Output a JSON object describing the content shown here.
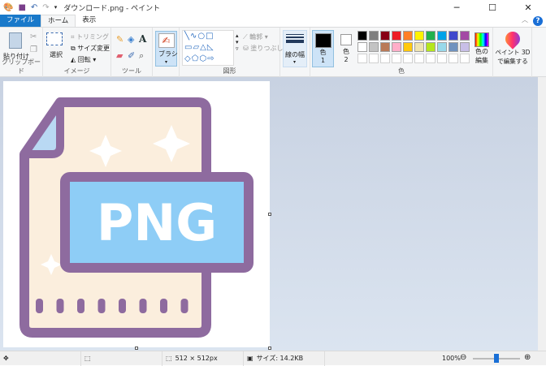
{
  "window": {
    "title": "ダウンロード.png - ペイント",
    "minimize": "─",
    "maximize": "☐",
    "close": "✕"
  },
  "tabs": [
    {
      "label": "ファイル"
    },
    {
      "label": "ホーム"
    },
    {
      "label": "表示"
    }
  ],
  "ribbon": {
    "clipboard": {
      "paste": "貼り付け",
      "label": "クリップボード"
    },
    "image": {
      "select": "選択",
      "crop": "トリミング",
      "resize": "サイズ変更",
      "rotate": "回転",
      "label": "イメージ"
    },
    "tools": {
      "label": "ツール"
    },
    "brush": {
      "label": "ブラシ"
    },
    "shapes": {
      "outline": "輪郭",
      "fill": "塗りつぶし",
      "label": "図形"
    },
    "size": {
      "label": "線の幅"
    },
    "colors": {
      "color1": "色\n1",
      "color1_a": "色",
      "color1_b": "1",
      "color2_a": "色",
      "color2_b": "2",
      "edit_a": "色の",
      "edit_b": "編集",
      "label": "色",
      "color1_value": "#000000",
      "color2_value": "#ffffff",
      "palette_row1": [
        "#000000",
        "#7f7f7f",
        "#880015",
        "#ed1c24",
        "#ff7f27",
        "#fff200",
        "#22b14c",
        "#00a2e8",
        "#3f48cc",
        "#a349a4"
      ],
      "palette_row2": [
        "#ffffff",
        "#c3c3c3",
        "#b97a57",
        "#ffaec9",
        "#ffc90e",
        "#efe4b0",
        "#b5e61d",
        "#99d9ea",
        "#7092be",
        "#c8bfe7"
      ]
    },
    "paint3d": {
      "line1": "ペイント 3D",
      "line2": "で編集する"
    }
  },
  "canvas": {
    "image_text": "PNG"
  },
  "status": {
    "dimensions": "512 × 512px",
    "size": "サイズ: 14.2KB",
    "zoom": "100%",
    "zoom_fraction": 0.5
  }
}
